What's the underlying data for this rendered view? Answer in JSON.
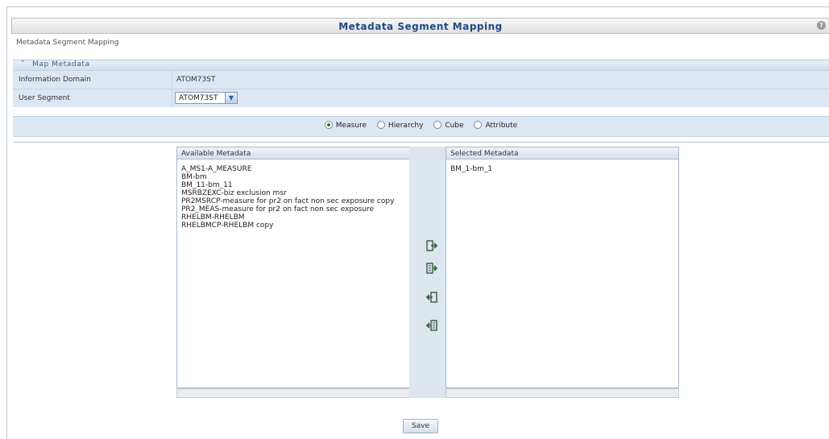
{
  "header": {
    "title": "Metadata Segment Mapping",
    "help_icon": "help-icon"
  },
  "breadcrumb": "Metadata Segment Mapping",
  "section": {
    "title": "Map Metadata"
  },
  "form": {
    "info_domain_label": "Information Domain",
    "info_domain_value": "ATOM73ST",
    "user_segment_label": "User Segment",
    "user_segment_value": "ATOM73ST"
  },
  "radios": [
    {
      "label": "Measure",
      "selected": true
    },
    {
      "label": "Hierarchy",
      "selected": false
    },
    {
      "label": "Cube",
      "selected": false
    },
    {
      "label": "Attribute",
      "selected": false
    }
  ],
  "available": {
    "title": "Available Metadata",
    "items": [
      "A_MS1-A_MEASURE",
      "BM-bm",
      "BM_11-bm_11",
      "MSRBZEXC-biz exclusion msr",
      "PR2MSRCP-measure for pr2 on fact non sec exposure copy",
      "PR2_MEAS-measure for pr2 on fact non sec exposure",
      "RHELBM-RHELBM",
      "RHELBMCP-RHELBM copy"
    ]
  },
  "selected": {
    "title": "Selected Metadata",
    "items": [
      "BM_1-bm_1"
    ]
  },
  "move_buttons": [
    "move-selected-right-icon",
    "move-all-right-icon",
    "move-selected-left-icon",
    "move-all-left-icon"
  ],
  "save_label": "Save",
  "colors": {
    "title_text": "#23488a",
    "row_bg": "#dde7f2",
    "radio_dot": "#2a7a2a"
  }
}
